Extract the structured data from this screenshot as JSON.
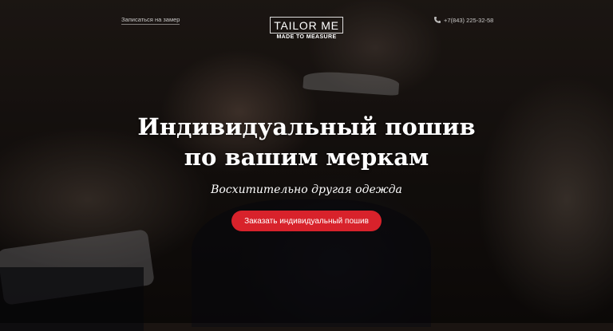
{
  "header": {
    "signup_link": "Записаться на замер",
    "logo_text": "TAILOR ME",
    "logo_tagline": "MADE TO MEASURE",
    "phone": "+7(843) 225-32-58",
    "phone_icon": "phone-icon"
  },
  "hero": {
    "title_line1": "Индивидуальный пошив",
    "title_line2": "по вашим меркам",
    "subtitle": "Восхитительно другая одежда",
    "cta_label": "Заказать индивидуальный пошив"
  },
  "colors": {
    "accent": "#d8222b",
    "text": "#ffffff"
  }
}
